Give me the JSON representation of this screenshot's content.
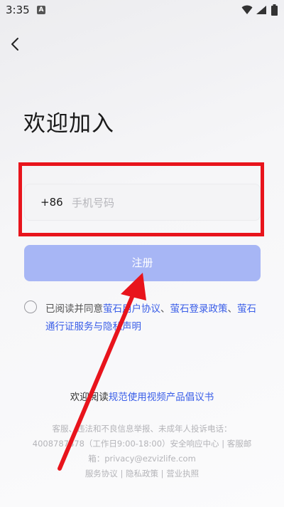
{
  "status_bar": {
    "time": "3:35",
    "notification_icon": "A"
  },
  "header": {
    "back_icon": "chevron-left-icon"
  },
  "page": {
    "title": "欢迎加入"
  },
  "phone_form": {
    "country_code": "+86",
    "placeholder": "手机号码",
    "value": ""
  },
  "register": {
    "label": "注册"
  },
  "agreement": {
    "prefix": "已阅读并同意",
    "link1": "萤石用户协议",
    "sep1": "、",
    "link2": "萤石登录政策",
    "sep2": "、",
    "link3": "萤石通行证服务与隐私声明"
  },
  "initiative": {
    "prefix": "欢迎阅读",
    "link": "规范使用视频产品倡议书"
  },
  "footer": {
    "line1": "客服、违法和不良信息举报、未成年人投诉电话：",
    "line2": "4008787878（工作日9:00-18:00）安全响应中心 | 客服邮",
    "line3": "箱：privacy@ezvizlife.com",
    "links": {
      "service": "服务协议",
      "privacy": "隐私政策",
      "license": "营业执照"
    },
    "divider": " | "
  },
  "colors": {
    "accent": "#3a5ee8",
    "register_disabled": "#a7b6f5",
    "annotation_red": "#e8141c"
  }
}
